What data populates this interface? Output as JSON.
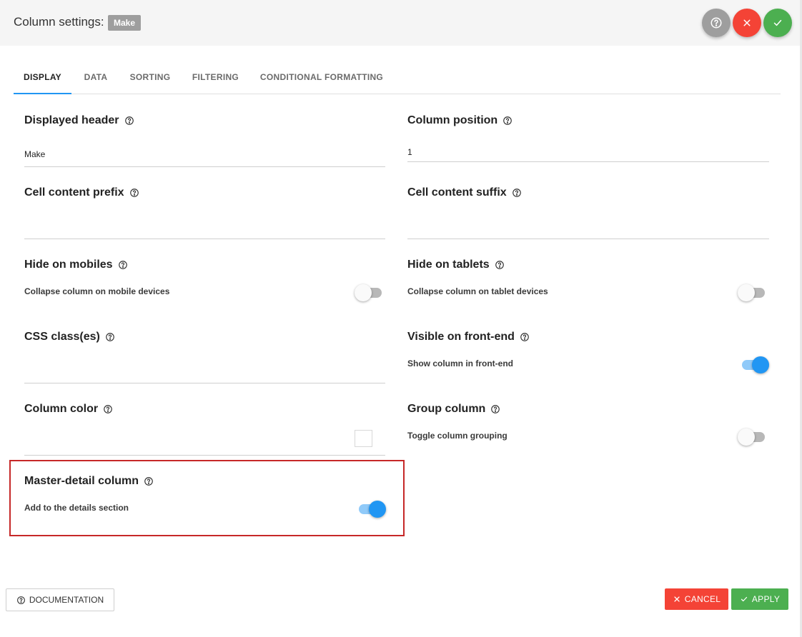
{
  "header": {
    "title": "Column settings:",
    "badge": "Make",
    "background": "#f5f5f5"
  },
  "header_buttons": {
    "help": {
      "icon": "help-circle-icon",
      "color": "#9e9e9e"
    },
    "close": {
      "icon": "close-icon",
      "color": "#f44336"
    },
    "confirm": {
      "icon": "check-icon",
      "color": "#4caf50"
    }
  },
  "tabs": [
    {
      "label": "DISPLAY",
      "active": true
    },
    {
      "label": "DATA",
      "active": false
    },
    {
      "label": "SORTING",
      "active": false
    },
    {
      "label": "FILTERING",
      "active": false
    },
    {
      "label": "CONDITIONAL FORMATTING",
      "active": false
    }
  ],
  "fields": {
    "displayed_header": {
      "label": "Displayed header",
      "value": "Make"
    },
    "column_position": {
      "label": "Column position",
      "value": "1"
    },
    "cell_prefix": {
      "label": "Cell content prefix",
      "value": ""
    },
    "cell_suffix": {
      "label": "Cell content suffix",
      "value": ""
    },
    "hide_mobiles": {
      "label": "Hide on mobiles",
      "sublabel": "Collapse column on mobile devices",
      "enabled": false
    },
    "hide_tablets": {
      "label": "Hide on tablets",
      "sublabel": "Collapse column on tablet devices",
      "enabled": false
    },
    "css_classes": {
      "label": "CSS class(es)",
      "value": ""
    },
    "visible_frontend": {
      "label": "Visible on front-end",
      "sublabel": "Show column in front-end",
      "enabled": true
    },
    "column_color": {
      "label": "Column color",
      "value": "#ffffff"
    },
    "group_column": {
      "label": "Group column",
      "sublabel": "Toggle column grouping",
      "enabled": false
    },
    "master_detail": {
      "label": "Master-detail column",
      "sublabel": "Add to the details section",
      "enabled": true
    }
  },
  "footer": {
    "documentation": "DOCUMENTATION",
    "cancel": "CANCEL",
    "apply": "APPLY"
  },
  "colors": {
    "accent": "#2196f3",
    "danger": "#f44336",
    "success": "#4caf50",
    "highlight": "#c62828"
  }
}
